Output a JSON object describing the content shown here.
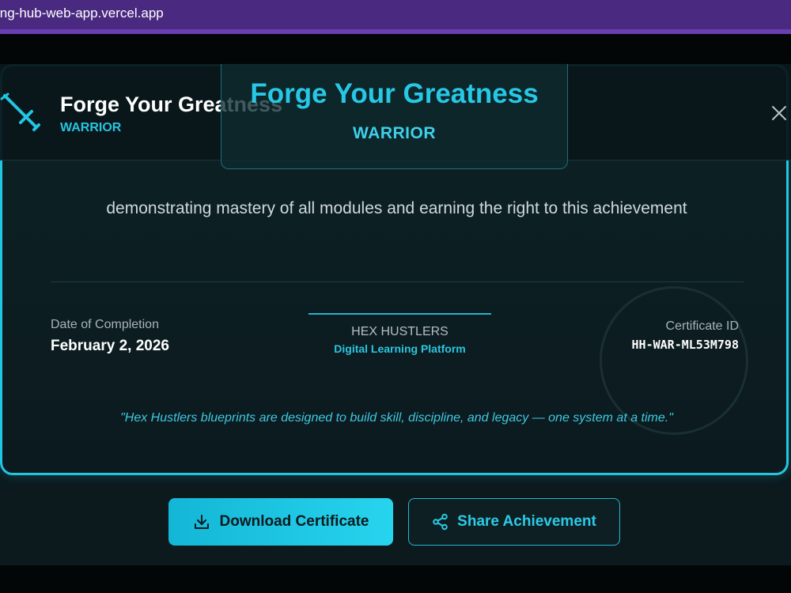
{
  "browser": {
    "url": "ing-hub-web-app.vercel.app"
  },
  "header": {
    "title": "Forge Your Greatness",
    "rank": "WARRIOR"
  },
  "certificate": {
    "title": "Forge Your Greatness",
    "subtitle": "WARRIOR",
    "statement": "demonstrating mastery of all modules and earning the right to this achievement",
    "date_label": "Date of Completion",
    "date_value": "February 2, 2026",
    "org_name": "HEX HUSTLERS",
    "org_subtitle": "Digital Learning Platform",
    "id_label": "Certificate ID",
    "id_value": "HH-WAR-ML53M798",
    "quote": "\"Hex Hustlers blueprints are designed to build skill, discipline, and legacy — one system at a time.\""
  },
  "actions": {
    "download_label": "Download Certificate",
    "share_label": "Share Achievement"
  },
  "colors": {
    "accent": "#22c6e2",
    "background": "#0c1a1e",
    "browser_bar": "#4a2a80"
  },
  "icons": {
    "header": "sword-icon",
    "close": "close-icon",
    "download": "download-icon",
    "share": "share-icon"
  }
}
